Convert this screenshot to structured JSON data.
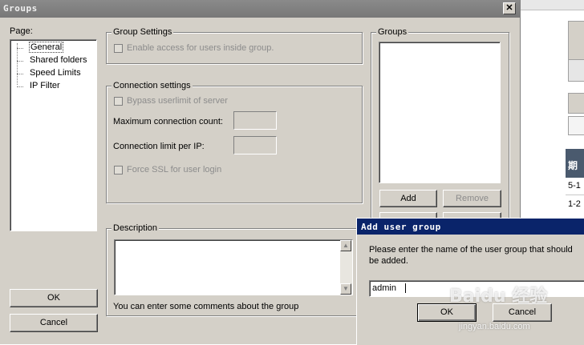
{
  "window": {
    "title": "Groups",
    "close": "✕"
  },
  "page_panel": {
    "label": "Page:",
    "items": [
      "General",
      "Shared folders",
      "Speed Limits",
      "IP Filter"
    ]
  },
  "group_settings": {
    "title": "Group Settings",
    "enable_access": "Enable access for users inside group."
  },
  "connection_settings": {
    "title": "Connection settings",
    "bypass": "Bypass userlimit of server",
    "max_conn": "Maximum connection count:",
    "limit_per_ip": "Connection limit per IP:",
    "force_ssl": "Force SSL for user login"
  },
  "groups_panel": {
    "title": "Groups",
    "add": "Add",
    "remove": "Remove"
  },
  "description": {
    "title": "Description",
    "hint": "You can enter some comments about the group"
  },
  "buttons": {
    "ok": "OK",
    "cancel": "Cancel"
  },
  "dialog": {
    "title": "Add user group",
    "prompt": "Please enter the name of the user group that should be added.",
    "value": "admin",
    "ok": "OK",
    "cancel": "Cancel"
  },
  "background_window": {
    "header_char": "期",
    "rows": [
      "5-1",
      "1-2"
    ]
  },
  "watermark": {
    "brand": "Baidu 经验",
    "url": "jingyan.baidu.com"
  }
}
